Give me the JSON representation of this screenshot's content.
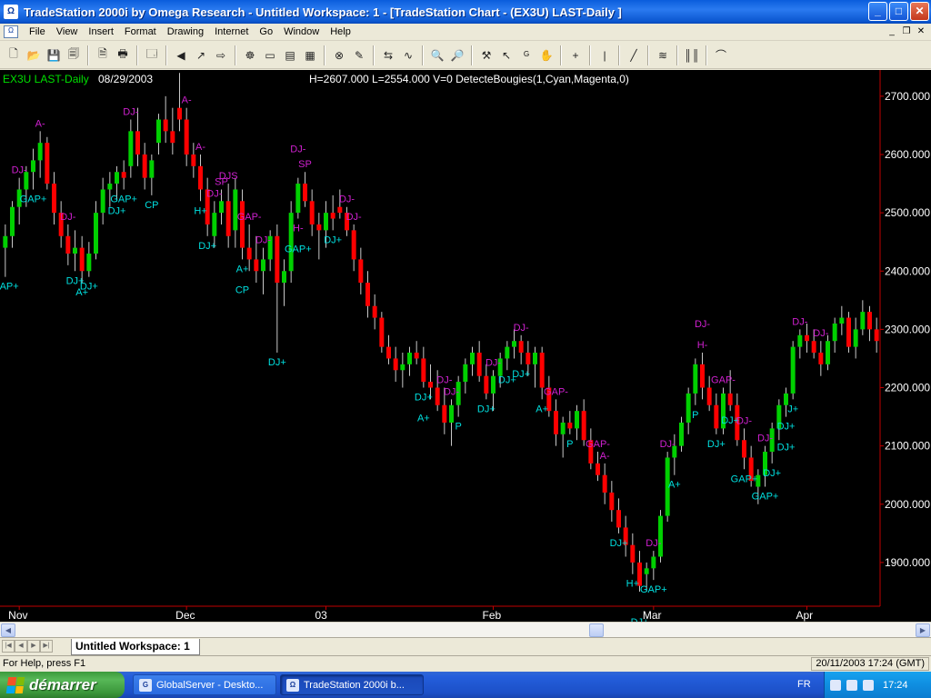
{
  "window": {
    "title": "TradeStation 2000i by Omega Research - Untitled Workspace:  1 - [TradeStation Chart - (EX3U)  LAST-Daily ]",
    "app_icon_text": "Ω",
    "minimize": "_",
    "maximize": "□",
    "close": "✕"
  },
  "menu": {
    "items": [
      "File",
      "View",
      "Insert",
      "Format",
      "Drawing",
      "Internet",
      "Go",
      "Window",
      "Help"
    ],
    "mdi_min": "_",
    "mdi_restore": "❐",
    "mdi_close": "✕"
  },
  "toolbar": {
    "icons": [
      "new-icon",
      "open-icon",
      "save-icon",
      "save-all-icon",
      "|",
      "print-preview-icon",
      "print-icon",
      "|",
      "properties-icon",
      "|",
      "back-icon",
      "forward-icon",
      "insert-icon",
      "|",
      "indicator-icon",
      "strategy-icon",
      "window-icon",
      "grid-icon",
      "|",
      "format-icon",
      "draw-icon",
      "|",
      "pointer-icon",
      "chart-analysis-icon",
      "|",
      "zoom-in-icon",
      "zoom-out-icon",
      "|",
      "tools-icon",
      "cursor-icon",
      "gann-icon",
      "hand-icon",
      "|",
      "crosshair-icon",
      "|",
      "vertical-line-icon",
      "|",
      "trendline-icon",
      "|",
      "fibonacci-icon",
      "|",
      "bars-icon",
      "|",
      "arc-icon"
    ],
    "glyphs": [
      "🗋",
      "📂",
      "💾",
      "🗐",
      "|",
      "🗎",
      "🖶",
      "|",
      "🗔",
      "|",
      "◀",
      "↗",
      "⇨",
      "|",
      "☸",
      "▭",
      "▤",
      "▦",
      "|",
      "⊗",
      "✎",
      "|",
      "⇆",
      "∿",
      "|",
      "🔍",
      "🔎",
      "|",
      "⚒",
      "↖",
      "ᴳ",
      "✋",
      "|",
      "+",
      "|",
      "|",
      "|",
      "╱",
      "|",
      "≋",
      "|",
      "║║",
      "|",
      "⌒"
    ]
  },
  "chart_header": {
    "symbol": "EX3U LAST-Daily",
    "date": "08/29/2003",
    "info": "H=2607.000  L=2554.000  V=0  DetecteBougies(1,Cyan,Magenta,0)"
  },
  "chart_data": {
    "type": "candlestick",
    "symbol": "EX3U",
    "interval": "Daily",
    "x_labels": [
      {
        "label": "Nov",
        "index": 2
      },
      {
        "label": "Dec",
        "index": 26
      },
      {
        "label": "03",
        "index": 46
      },
      {
        "label": "Feb",
        "index": 70
      },
      {
        "label": "Mar",
        "index": 93
      },
      {
        "label": "Apr",
        "index": 115
      }
    ],
    "y_ticks": [
      1900,
      2000,
      2100,
      2200,
      2300,
      2400,
      2500,
      2600,
      2700
    ],
    "y_tick_labels": [
      "1900.000",
      "2000.000",
      "2100.000",
      "2200.000",
      "2300.000",
      "2400.000",
      "2500.000",
      "2600.000",
      "2700.000"
    ],
    "ylim": [
      1825,
      2745
    ],
    "colors": {
      "up": "#00d000",
      "down": "#ff0000",
      "bull_signal": "#00e0e0",
      "bear_signal": "#d020d0",
      "axis": "#c00000",
      "wick": "#c8c8c8"
    },
    "candles": [
      [
        2440,
        2480,
        2390,
        2460
      ],
      [
        2460,
        2520,
        2440,
        2510
      ],
      [
        2510,
        2560,
        2480,
        2540
      ],
      [
        2540,
        2580,
        2510,
        2570
      ],
      [
        2570,
        2610,
        2540,
        2590
      ],
      [
        2590,
        2640,
        2560,
        2620
      ],
      [
        2620,
        2630,
        2540,
        2550
      ],
      [
        2550,
        2570,
        2480,
        2500
      ],
      [
        2500,
        2520,
        2440,
        2460
      ],
      [
        2460,
        2480,
        2410,
        2430
      ],
      [
        2430,
        2470,
        2400,
        2440
      ],
      [
        2440,
        2460,
        2380,
        2400
      ],
      [
        2400,
        2450,
        2390,
        2430
      ],
      [
        2430,
        2520,
        2420,
        2500
      ],
      [
        2500,
        2560,
        2480,
        2540
      ],
      [
        2540,
        2570,
        2510,
        2550
      ],
      [
        2550,
        2580,
        2520,
        2570
      ],
      [
        2570,
        2590,
        2540,
        2560
      ],
      [
        2580,
        2660,
        2560,
        2640
      ],
      [
        2640,
        2680,
        2580,
        2600
      ],
      [
        2600,
        2620,
        2540,
        2560
      ],
      [
        2560,
        2600,
        2530,
        2590
      ],
      [
        2620,
        2670,
        2600,
        2660
      ],
      [
        2660,
        2700,
        2620,
        2640
      ],
      [
        2640,
        2680,
        2600,
        2620
      ],
      [
        2680,
        2740,
        2640,
        2660
      ],
      [
        2660,
        2680,
        2580,
        2600
      ],
      [
        2600,
        2620,
        2560,
        2580
      ],
      [
        2580,
        2600,
        2520,
        2540
      ],
      [
        2540,
        2560,
        2460,
        2480
      ],
      [
        2460,
        2520,
        2440,
        2500
      ],
      [
        2500,
        2540,
        2480,
        2520
      ],
      [
        2520,
        2550,
        2440,
        2460
      ],
      [
        2470,
        2560,
        2440,
        2540
      ],
      [
        2520,
        2540,
        2420,
        2440
      ],
      [
        2440,
        2480,
        2400,
        2420
      ],
      [
        2420,
        2460,
        2380,
        2400
      ],
      [
        2400,
        2440,
        2360,
        2420
      ],
      [
        2420,
        2470,
        2400,
        2460
      ],
      [
        2460,
        2480,
        2260,
        2380
      ],
      [
        2380,
        2420,
        2340,
        2400
      ],
      [
        2400,
        2520,
        2380,
        2500
      ],
      [
        2500,
        2560,
        2490,
        2550
      ],
      [
        2550,
        2570,
        2510,
        2520
      ],
      [
        2520,
        2540,
        2460,
        2480
      ],
      [
        2480,
        2500,
        2420,
        2470
      ],
      [
        2470,
        2520,
        2440,
        2500
      ],
      [
        2500,
        2530,
        2470,
        2490
      ],
      [
        2510,
        2540,
        2490,
        2500
      ],
      [
        2500,
        2510,
        2460,
        2470
      ],
      [
        2470,
        2480,
        2400,
        2420
      ],
      [
        2420,
        2440,
        2360,
        2380
      ],
      [
        2380,
        2400,
        2320,
        2340
      ],
      [
        2340,
        2360,
        2300,
        2320
      ],
      [
        2320,
        2330,
        2260,
        2270
      ],
      [
        2270,
        2290,
        2240,
        2250
      ],
      [
        2250,
        2270,
        2210,
        2230
      ],
      [
        2230,
        2260,
        2200,
        2240
      ],
      [
        2240,
        2270,
        2220,
        2260
      ],
      [
        2260,
        2280,
        2240,
        2250
      ],
      [
        2250,
        2270,
        2200,
        2210
      ],
      [
        2210,
        2240,
        2180,
        2200
      ],
      [
        2200,
        2230,
        2160,
        2170
      ],
      [
        2170,
        2200,
        2120,
        2140
      ],
      [
        2140,
        2180,
        2100,
        2170
      ],
      [
        2170,
        2220,
        2150,
        2210
      ],
      [
        2210,
        2250,
        2190,
        2240
      ],
      [
        2240,
        2270,
        2220,
        2260
      ],
      [
        2260,
        2280,
        2210,
        2220
      ],
      [
        2220,
        2240,
        2180,
        2190
      ],
      [
        2190,
        2230,
        2160,
        2220
      ],
      [
        2220,
        2260,
        2200,
        2250
      ],
      [
        2250,
        2280,
        2230,
        2270
      ],
      [
        2270,
        2300,
        2250,
        2280
      ],
      [
        2280,
        2290,
        2240,
        2260
      ],
      [
        2260,
        2280,
        2220,
        2240
      ],
      [
        2240,
        2270,
        2200,
        2260
      ],
      [
        2260,
        2270,
        2180,
        2200
      ],
      [
        2200,
        2220,
        2150,
        2160
      ],
      [
        2160,
        2180,
        2100,
        2120
      ],
      [
        2120,
        2150,
        2080,
        2140
      ],
      [
        2140,
        2160,
        2120,
        2130
      ],
      [
        2130,
        2170,
        2110,
        2160
      ],
      [
        2160,
        2180,
        2100,
        2110
      ],
      [
        2110,
        2130,
        2060,
        2070
      ],
      [
        2070,
        2090,
        2040,
        2050
      ],
      [
        2050,
        2070,
        2000,
        2020
      ],
      [
        2020,
        2040,
        1970,
        1990
      ],
      [
        1990,
        2010,
        1950,
        1960
      ],
      [
        1960,
        1980,
        1910,
        1930
      ],
      [
        1930,
        1950,
        1880,
        1900
      ],
      [
        1900,
        1920,
        1850,
        1860
      ],
      [
        1880,
        1900,
        1850,
        1890
      ],
      [
        1890,
        1920,
        1870,
        1910
      ],
      [
        1910,
        1990,
        1900,
        1980
      ],
      [
        1980,
        2090,
        1970,
        2080
      ],
      [
        2080,
        2120,
        2050,
        2100
      ],
      [
        2100,
        2150,
        2090,
        2140
      ],
      [
        2140,
        2200,
        2120,
        2190
      ],
      [
        2190,
        2250,
        2170,
        2240
      ],
      [
        2240,
        2260,
        2180,
        2200
      ],
      [
        2200,
        2220,
        2160,
        2170
      ],
      [
        2170,
        2190,
        2120,
        2130
      ],
      [
        2130,
        2200,
        2120,
        2190
      ],
      [
        2190,
        2230,
        2160,
        2170
      ],
      [
        2170,
        2190,
        2100,
        2110
      ],
      [
        2110,
        2130,
        2060,
        2080
      ],
      [
        2080,
        2100,
        2030,
        2040
      ],
      [
        2030,
        2060,
        2000,
        2050
      ],
      [
        2050,
        2100,
        2030,
        2090
      ],
      [
        2090,
        2140,
        2070,
        2130
      ],
      [
        2130,
        2180,
        2110,
        2170
      ],
      [
        2170,
        2200,
        2150,
        2190
      ],
      [
        2190,
        2280,
        2180,
        2270
      ],
      [
        2270,
        2300,
        2250,
        2290
      ],
      [
        2290,
        2310,
        2260,
        2280
      ],
      [
        2280,
        2300,
        2250,
        2260
      ],
      [
        2260,
        2280,
        2220,
        2240
      ],
      [
        2240,
        2290,
        2230,
        2280
      ],
      [
        2280,
        2320,
        2260,
        2310
      ],
      [
        2310,
        2340,
        2290,
        2320
      ],
      [
        2320,
        2330,
        2260,
        2270
      ],
      [
        2270,
        2320,
        2250,
        2300
      ],
      [
        2300,
        2350,
        2290,
        2330
      ],
      [
        2330,
        2340,
        2280,
        2300
      ],
      [
        2300,
        2320,
        2260,
        2280
      ]
    ],
    "annotations": [
      {
        "i": 0,
        "text": "GAP+",
        "pos": "below",
        "kind": "bull"
      },
      {
        "i": 2,
        "text": "DJ-",
        "pos": "above",
        "kind": "bear"
      },
      {
        "i": 5,
        "text": "A-",
        "pos": "above",
        "kind": "bear"
      },
      {
        "i": 4,
        "text": "GAP+",
        "pos": "below",
        "kind": "bull"
      },
      {
        "i": 9,
        "text": "DJ-",
        "pos": "above",
        "kind": "bear"
      },
      {
        "i": 10,
        "text": "DJ+",
        "pos": "below",
        "kind": "bull"
      },
      {
        "i": 11,
        "text": "A+",
        "pos": "below",
        "kind": "bull"
      },
      {
        "i": 12,
        "text": "DJ+",
        "pos": "below",
        "kind": "bull"
      },
      {
        "i": 18,
        "text": "DJ-",
        "pos": "above",
        "kind": "bear"
      },
      {
        "i": 17,
        "text": "GAP+",
        "pos": "below",
        "kind": "bull"
      },
      {
        "i": 16,
        "text": "DJ+",
        "pos": "below",
        "kind": "bull"
      },
      {
        "i": 21,
        "text": "CP",
        "pos": "below",
        "kind": "bull"
      },
      {
        "i": 26,
        "text": "A-",
        "pos": "above",
        "kind": "bear"
      },
      {
        "i": 28,
        "text": "A-",
        "pos": "above",
        "kind": "bear"
      },
      {
        "i": 28,
        "text": "H+",
        "pos": "below",
        "kind": "bull"
      },
      {
        "i": 30,
        "text": "DJ-",
        "pos": "above",
        "kind": "bear"
      },
      {
        "i": 31,
        "text": "SP",
        "pos": "above",
        "kind": "bear"
      },
      {
        "i": 32,
        "text": "DJS",
        "pos": "above",
        "kind": "bear"
      },
      {
        "i": 29,
        "text": "DJ+",
        "pos": "below",
        "kind": "bull"
      },
      {
        "i": 35,
        "text": "GAP-",
        "pos": "above",
        "kind": "bear"
      },
      {
        "i": 37,
        "text": "DJ-",
        "pos": "above",
        "kind": "bear"
      },
      {
        "i": 34,
        "text": "A+",
        "pos": "below",
        "kind": "bull"
      },
      {
        "i": 34,
        "text": "CP",
        "pos": "below2",
        "kind": "bull"
      },
      {
        "i": 39,
        "text": "DJ+",
        "pos": "below",
        "kind": "bull"
      },
      {
        "i": 42,
        "text": "DJ-",
        "pos": "above2",
        "kind": "bear"
      },
      {
        "i": 43,
        "text": "SP",
        "pos": "above",
        "kind": "bear"
      },
      {
        "i": 42,
        "text": "H-",
        "pos": "below",
        "kind": "bear"
      },
      {
        "i": 42,
        "text": "GAP+",
        "pos": "below2",
        "kind": "bull"
      },
      {
        "i": 47,
        "text": "DJ+",
        "pos": "below",
        "kind": "bull"
      },
      {
        "i": 49,
        "text": "DJ-",
        "pos": "above",
        "kind": "bear"
      },
      {
        "i": 50,
        "text": "DJ-",
        "pos": "above",
        "kind": "bear"
      },
      {
        "i": 63,
        "text": "DJ-",
        "pos": "above",
        "kind": "bear"
      },
      {
        "i": 64,
        "text": "DJ-",
        "pos": "above",
        "kind": "bear"
      },
      {
        "i": 60,
        "text": "DJ+",
        "pos": "below",
        "kind": "bull"
      },
      {
        "i": 60,
        "text": "A+",
        "pos": "below2",
        "kind": "bull"
      },
      {
        "i": 65,
        "text": "P",
        "pos": "below",
        "kind": "bull"
      },
      {
        "i": 70,
        "text": "DJ-",
        "pos": "above",
        "kind": "bear"
      },
      {
        "i": 69,
        "text": "DJ+",
        "pos": "below",
        "kind": "bull"
      },
      {
        "i": 72,
        "text": "DJ+",
        "pos": "below",
        "kind": "bull"
      },
      {
        "i": 74,
        "text": "DJ-",
        "pos": "above",
        "kind": "bear"
      },
      {
        "i": 74,
        "text": "DJ+",
        "pos": "below",
        "kind": "bull"
      },
      {
        "i": 77,
        "text": "A+",
        "pos": "below",
        "kind": "bull"
      },
      {
        "i": 79,
        "text": "GAP-",
        "pos": "above",
        "kind": "bear"
      },
      {
        "i": 81,
        "text": "P",
        "pos": "below",
        "kind": "bull"
      },
      {
        "i": 85,
        "text": "GAP-",
        "pos": "above",
        "kind": "bear"
      },
      {
        "i": 86,
        "text": "A-",
        "pos": "above",
        "kind": "bear"
      },
      {
        "i": 88,
        "text": "DJ+",
        "pos": "below",
        "kind": "bull"
      },
      {
        "i": 90,
        "text": "H+",
        "pos": "below",
        "kind": "bull"
      },
      {
        "i": 91,
        "text": "DJ+",
        "pos": "below2",
        "kind": "bull"
      },
      {
        "i": 93,
        "text": "DJ-",
        "pos": "above",
        "kind": "bear"
      },
      {
        "i": 93,
        "text": "GAP+",
        "pos": "below",
        "kind": "bull"
      },
      {
        "i": 95,
        "text": "DJ-",
        "pos": "above",
        "kind": "bear"
      },
      {
        "i": 96,
        "text": "A+",
        "pos": "below",
        "kind": "bull"
      },
      {
        "i": 100,
        "text": "DJ-",
        "pos": "above2",
        "kind": "bear"
      },
      {
        "i": 100,
        "text": "H-",
        "pos": "above",
        "kind": "bear"
      },
      {
        "i": 99,
        "text": "P",
        "pos": "below",
        "kind": "bull"
      },
      {
        "i": 102,
        "text": "DJ+",
        "pos": "below",
        "kind": "bull"
      },
      {
        "i": 103,
        "text": "GAP-",
        "pos": "above",
        "kind": "bear"
      },
      {
        "i": 104,
        "text": "DJ+",
        "pos": "below",
        "kind": "bull"
      },
      {
        "i": 106,
        "text": "DJ-",
        "pos": "above",
        "kind": "bear"
      },
      {
        "i": 106,
        "text": "GAP+",
        "pos": "below",
        "kind": "bull"
      },
      {
        "i": 109,
        "text": "DJ-",
        "pos": "above",
        "kind": "bear"
      },
      {
        "i": 109,
        "text": "GAP+",
        "pos": "below",
        "kind": "bull"
      },
      {
        "i": 110,
        "text": "DJ+",
        "pos": "below",
        "kind": "bull"
      },
      {
        "i": 112,
        "text": "DJ+",
        "pos": "below",
        "kind": "bull"
      },
      {
        "i": 113,
        "text": "J+",
        "pos": "below",
        "kind": "bull"
      },
      {
        "i": 112,
        "text": "DJ+",
        "pos": "below2",
        "kind": "bull"
      },
      {
        "i": 114,
        "text": "DJ-",
        "pos": "above",
        "kind": "bear"
      },
      {
        "i": 117,
        "text": "DJ-",
        "pos": "above",
        "kind": "bear"
      }
    ]
  },
  "scrollbar": {
    "left_arrow": "◀",
    "right_arrow": "▶"
  },
  "workspace": {
    "nav": [
      "|◀",
      "◀",
      "▶",
      "▶|"
    ],
    "tab_label": "Untitled Workspace:  1"
  },
  "status": {
    "help_text": "For Help, press F1",
    "datetime": "20/11/2003 17:24 (GMT)"
  },
  "taskbar": {
    "start_label": "démarrer",
    "buttons": [
      {
        "label": "GlobalServer - Deskto...",
        "icon": "G"
      },
      {
        "label": "TradeStation 2000i b...",
        "icon": "Ω"
      }
    ],
    "lang": "FR",
    "clock": "17:24"
  }
}
